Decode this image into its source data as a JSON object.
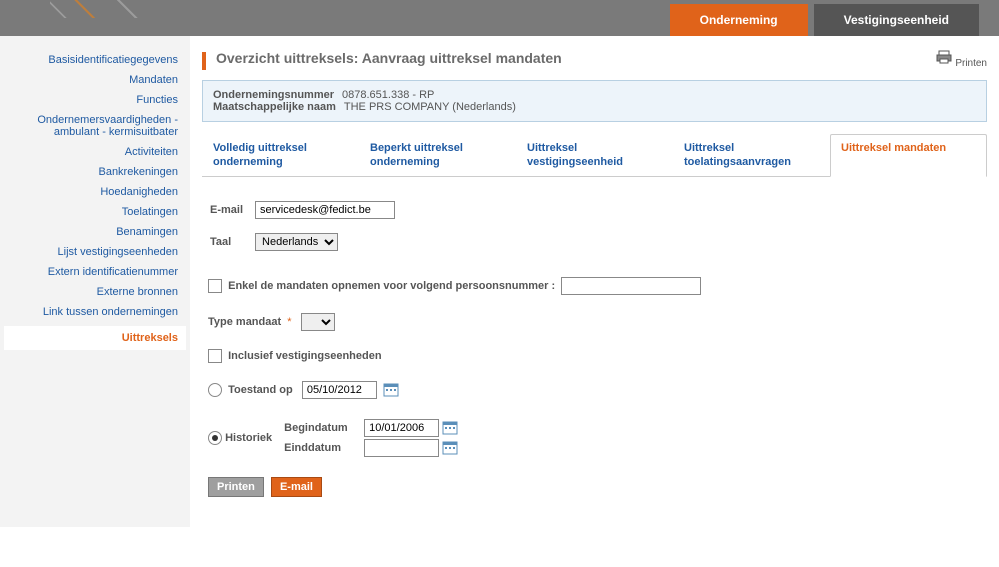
{
  "topTabs": {
    "onderneming": "Onderneming",
    "vestiging": "Vestigingseenheid"
  },
  "sidebar": {
    "items": [
      "Basisidentificatiegegevens",
      "Mandaten",
      "Functies",
      "Ondernemersvaardigheden - ambulant - kermisuitbater",
      "Activiteiten",
      "Bankrekeningen",
      "Hoedanigheden",
      "Toelatingen",
      "Benamingen",
      "Lijst vestigingseenheden",
      "Extern identificatienummer",
      "Externe bronnen",
      "Link tussen ondernemingen"
    ],
    "active": "Uittreksels"
  },
  "header": {
    "title": "Overzicht uittreksels: Aanvraag uittreksel mandaten",
    "printLabel": "Printen"
  },
  "infobox": {
    "nummerLabel": "Ondernemingsnummer",
    "nummer": "0878.651.338  - RP",
    "naamLabel": "Maatschappelijke naam",
    "naam": "THE PRS COMPANY (Nederlands)"
  },
  "tabs": {
    "t0": "Volledig uittreksel onderneming",
    "t1": "Beperkt uittreksel onderneming",
    "t2": "Uittreksel vestigingseenheid",
    "t3": "Uittreksel toelatingsaanvragen",
    "t4": "Uittreksel mandaten"
  },
  "form": {
    "emailLabel": "E-mail",
    "emailValue": "servicedesk@fedict.be",
    "taalLabel": "Taal",
    "taalValue": "Nederlands",
    "enkelMandaten": "Enkel de mandaten opnemen voor volgend persoonsnummer :",
    "typeMandaat": "Type mandaat",
    "inclusief": "Inclusief vestigingseenheden",
    "toestandOp": "Toestand op",
    "toestandDate": "05/10/2012",
    "historiek": "Historiek",
    "begindatumLabel": "Begindatum",
    "begindatum": "10/01/2006",
    "einddatumLabel": "Einddatum",
    "einddatum": "",
    "buttons": {
      "printen": "Printen",
      "email": "E-mail"
    }
  }
}
